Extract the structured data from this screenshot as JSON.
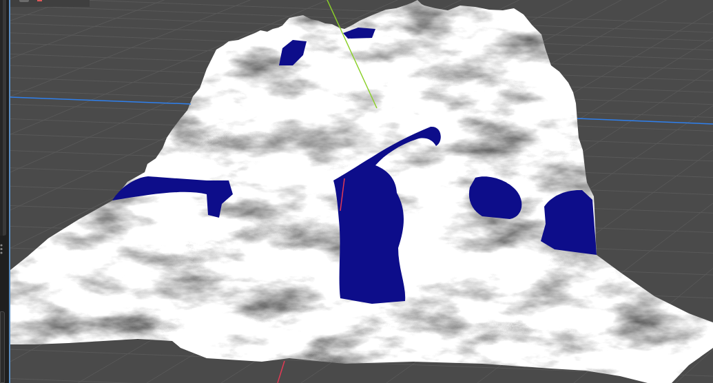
{
  "viewport": {
    "axes": [
      {
        "color": "#8bd02a"
      },
      {
        "color": "#2f80ee"
      },
      {
        "color": "#e23a55"
      }
    ]
  }
}
